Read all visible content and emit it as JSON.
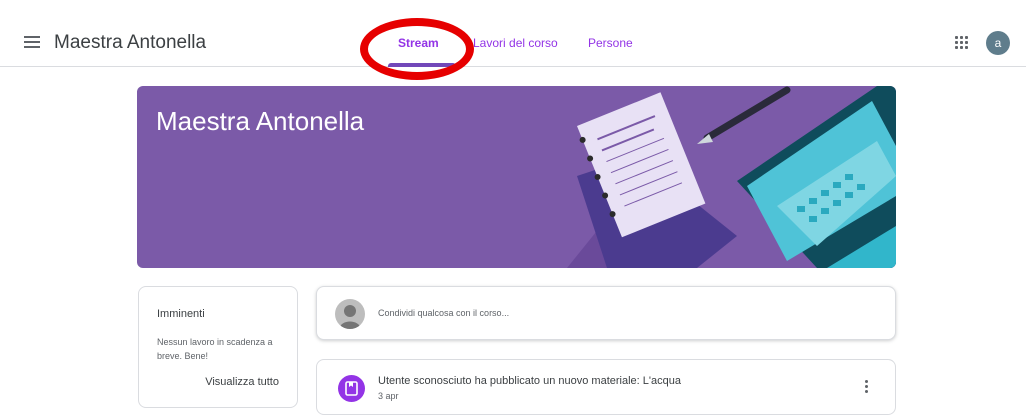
{
  "header": {
    "app_title": "Maestra Antonella",
    "tabs": [
      {
        "label": "Stream",
        "active": true
      },
      {
        "label": "Lavori del corso",
        "active": false
      },
      {
        "label": "Persone",
        "active": false
      }
    ],
    "avatar_letter": "a"
  },
  "banner": {
    "title": "Maestra Antonella",
    "color": "#7b5aa8"
  },
  "upcoming": {
    "title": "Imminenti",
    "text": "Nessun lavoro in scadenza a breve. Bene!",
    "view_all": "Visualizza tutto"
  },
  "share": {
    "placeholder": "Condividi qualcosa con il corso..."
  },
  "posts": [
    {
      "title": "Utente sconosciuto ha pubblicato un nuovo materiale: L'acqua",
      "date": "3 apr",
      "icon": "material-icon"
    }
  ],
  "colors": {
    "accent": "#9334e6",
    "annotation": "#e60000"
  }
}
